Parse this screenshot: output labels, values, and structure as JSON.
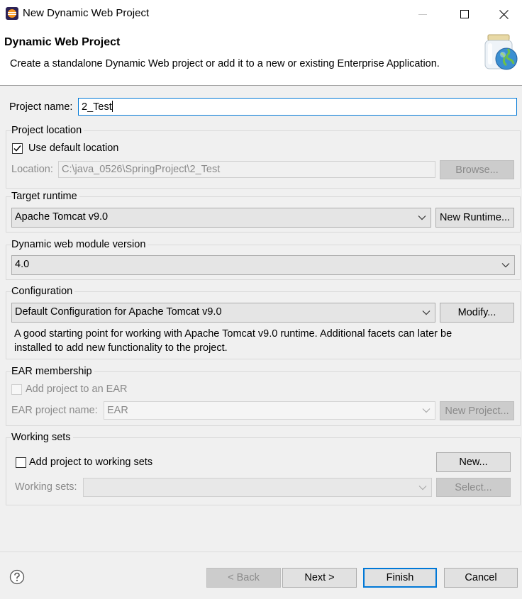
{
  "window": {
    "title": "New Dynamic Web Project"
  },
  "header": {
    "title": "Dynamic Web Project",
    "description": "Create a standalone Dynamic Web project or add it to a new or existing Enterprise Application."
  },
  "project_name": {
    "label": "Project name:",
    "value": "2_Test"
  },
  "project_location": {
    "legend": "Project location",
    "use_default_label": "Use default location",
    "use_default_checked": true,
    "location_label": "Location:",
    "location_value": "C:\\java_0526\\SpringProject\\2_Test",
    "browse_label": "Browse..."
  },
  "target_runtime": {
    "legend": "Target runtime",
    "selected": "Apache Tomcat v9.0",
    "new_runtime_label": "New Runtime..."
  },
  "module_version": {
    "legend": "Dynamic web module version",
    "selected": "4.0"
  },
  "configuration": {
    "legend": "Configuration",
    "selected": "Default Configuration for Apache Tomcat v9.0",
    "modify_label": "Modify...",
    "description_line1": "A good starting point for working with Apache Tomcat v9.0 runtime. Additional facets can later be",
    "description_line2": "installed to add new functionality to the project."
  },
  "ear": {
    "legend": "EAR membership",
    "add_label": "Add project to an EAR",
    "add_checked": false,
    "name_label": "EAR project name:",
    "name_value": "EAR",
    "new_project_label": "New Project..."
  },
  "working_sets": {
    "legend": "Working sets",
    "add_label": "Add project to working sets",
    "add_checked": false,
    "new_label": "New...",
    "sets_label": "Working sets:",
    "sets_value": "",
    "select_label": "Select..."
  },
  "footer": {
    "back_label": "< Back",
    "next_label": "Next >",
    "finish_label": "Finish",
    "cancel_label": "Cancel"
  },
  "icons": {
    "app": "eclipse-icon",
    "wizard": "web-project-jar-globe-icon",
    "help": "help-icon"
  },
  "colors": {
    "focus_accent": "#0078d7",
    "disabled_text": "#8a8a8a"
  }
}
